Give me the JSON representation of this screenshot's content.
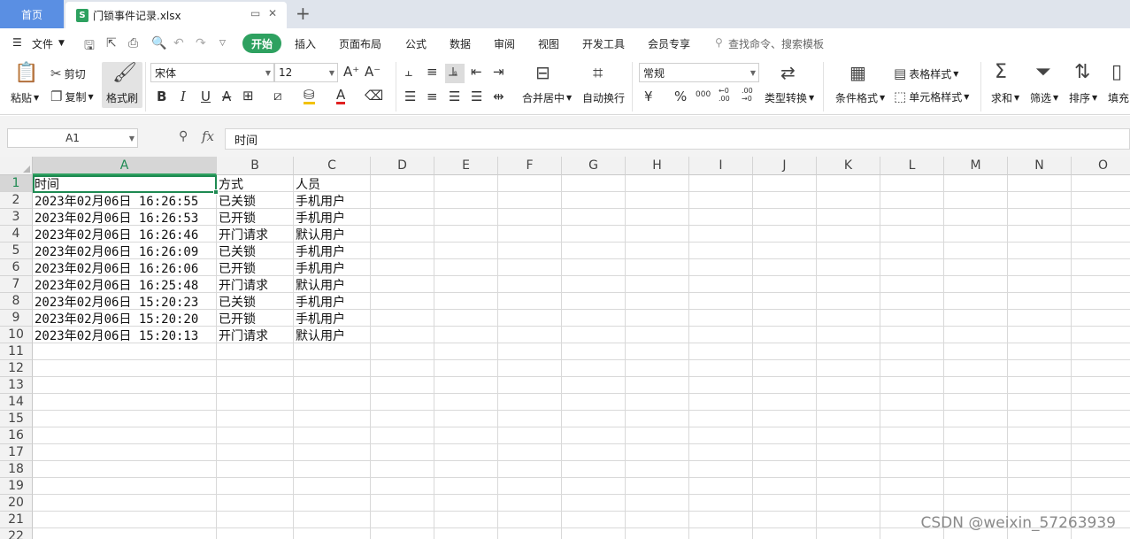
{
  "tabs": {
    "home": "首页",
    "file": "门锁事件记录.xlsx",
    "file_icon": "S",
    "add": "+"
  },
  "menu": {
    "file": "文件",
    "items": [
      "开始",
      "插入",
      "页面布局",
      "公式",
      "数据",
      "审阅",
      "视图",
      "开发工具",
      "会员专享"
    ],
    "search": "查找命令、搜索模板"
  },
  "ribbon": {
    "paste": "粘贴",
    "cut": "剪切",
    "copy": "复制",
    "format_painter": "格式刷",
    "font_name": "宋体",
    "font_size": "12",
    "merge": "合并居中",
    "wrap": "自动换行",
    "number_format": "常规",
    "type_convert": "类型转换",
    "cond_format": "条件格式",
    "table_style": "表格样式",
    "cell_style": "单元格样式",
    "sum": "求和",
    "filter": "筛选",
    "sort": "排序",
    "fill": "填充",
    "currency": "¥",
    "percent": "%",
    "thousands": "000",
    "inc_decimal": "←0 .00",
    "dec_decimal": ".00 →0"
  },
  "formula": {
    "cell_ref": "A1",
    "fx_label": "fx",
    "content": "时间"
  },
  "sheet": {
    "columns": [
      "A",
      "B",
      "C",
      "D",
      "E",
      "F",
      "G",
      "H",
      "I",
      "J",
      "K",
      "L",
      "M",
      "N",
      "O"
    ],
    "rows": [
      "1",
      "2",
      "3",
      "4",
      "5",
      "6",
      "7",
      "8",
      "9",
      "10",
      "11",
      "12",
      "13",
      "14",
      "15",
      "16",
      "17",
      "18",
      "19",
      "20",
      "21",
      "22"
    ],
    "data": [
      [
        "时间",
        "方式",
        "人员"
      ],
      [
        "2023年02月06日 16:26:55",
        "已关锁",
        "手机用户"
      ],
      [
        "2023年02月06日 16:26:53",
        "已开锁",
        "手机用户"
      ],
      [
        "2023年02月06日 16:26:46",
        "开门请求",
        "默认用户"
      ],
      [
        "2023年02月06日 16:26:09",
        "已关锁",
        "手机用户"
      ],
      [
        "2023年02月06日 16:26:06",
        "已开锁",
        "手机用户"
      ],
      [
        "2023年02月06日 16:25:48",
        "开门请求",
        "默认用户"
      ],
      [
        "2023年02月06日 15:20:23",
        "已关锁",
        "手机用户"
      ],
      [
        "2023年02月06日 15:20:20",
        "已开锁",
        "手机用户"
      ],
      [
        "2023年02月06日 15:20:13",
        "开门请求",
        "默认用户"
      ]
    ]
  },
  "watermark": "CSDN @weixin_57263939",
  "colors": {
    "accent": "#2ea160",
    "home_tab": "#5a8fe3",
    "selection": "#1e8a52"
  }
}
